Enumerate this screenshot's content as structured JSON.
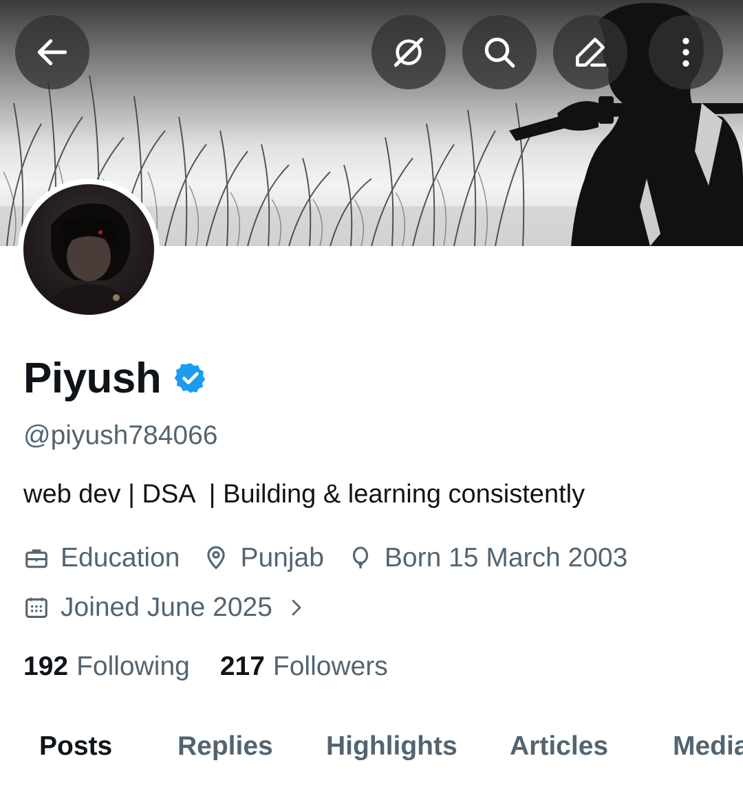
{
  "colors": {
    "text_primary": "#0f1419",
    "text_secondary": "#536471",
    "verified_blue": "#1d9bf0",
    "header_button_bg": "#323232"
  },
  "header": {
    "back_icon": "arrow-left-icon",
    "actions": [
      {
        "icon": "grok-icon"
      },
      {
        "icon": "search-icon"
      },
      {
        "icon": "edit-pencil-icon"
      },
      {
        "icon": "more-vertical-icon"
      }
    ]
  },
  "banner": {
    "description_icon": "banner-image"
  },
  "profile": {
    "display_name": "Piyush",
    "verified": true,
    "handle": "@piyush784066",
    "bio": "web dev | DSA  | Building & learning consistently",
    "professional_category": "Education",
    "location": "Punjab",
    "birthday": "Born 15 March 2003",
    "joined": "Joined June 2025"
  },
  "stats": {
    "following_count": "192",
    "following_label": "Following",
    "followers_count": "217",
    "followers_label": "Followers"
  },
  "tabs": [
    {
      "label": "Posts",
      "active": true
    },
    {
      "label": "Replies",
      "active": false
    },
    {
      "label": "Highlights",
      "active": false
    },
    {
      "label": "Articles",
      "active": false
    },
    {
      "label": "Media",
      "active": false
    }
  ]
}
